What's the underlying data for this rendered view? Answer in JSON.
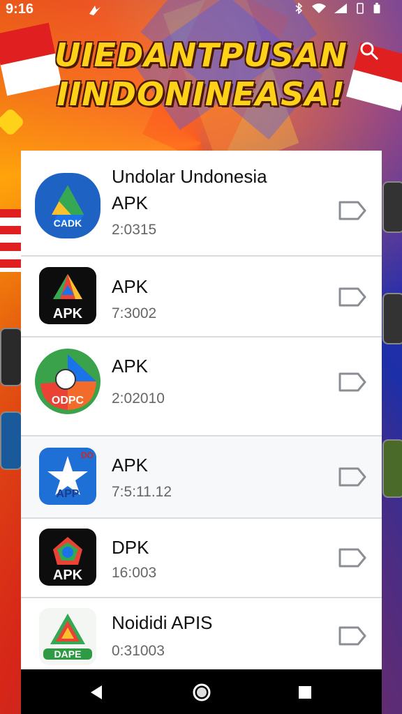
{
  "status_bar": {
    "time": "9:16"
  },
  "banner": {
    "line1": "UIEDANTPUSAN",
    "line2": "IINDONINEASA!"
  },
  "list": [
    {
      "title_line1": "Undolar Undonesia",
      "title_line2": "APK",
      "subtitle": "2:0315",
      "icon_text": "CADK",
      "icon_name": "drive-like-app-icon"
    },
    {
      "title_line1": "APK",
      "title_line2": "",
      "subtitle": "7:3002",
      "icon_text": "APK",
      "icon_name": "apk-triangle-app-icon"
    },
    {
      "title_line1": "APK",
      "title_line2": "",
      "subtitle": "2:02010",
      "icon_text": "ODPC",
      "icon_name": "odpc-app-icon"
    },
    {
      "title_line1": "APK",
      "title_line2": "",
      "subtitle": "7:5:11.12",
      "icon_text": "APP",
      "icon_badge": "DO",
      "icon_name": "star-app-icon"
    },
    {
      "title_line1": "DPK",
      "title_line2": "",
      "subtitle": "16:003",
      "icon_text": "APK",
      "icon_name": "dpk-app-icon"
    },
    {
      "title_line1": "Noididi APIS",
      "title_line2": "",
      "subtitle": "0:31003",
      "icon_text": "DAPE",
      "icon_name": "dape-app-icon"
    }
  ],
  "colors": {
    "accent_yellow": "#ffd21a",
    "banner_red": "#d62618",
    "banner_blue": "#1c2fa8"
  }
}
